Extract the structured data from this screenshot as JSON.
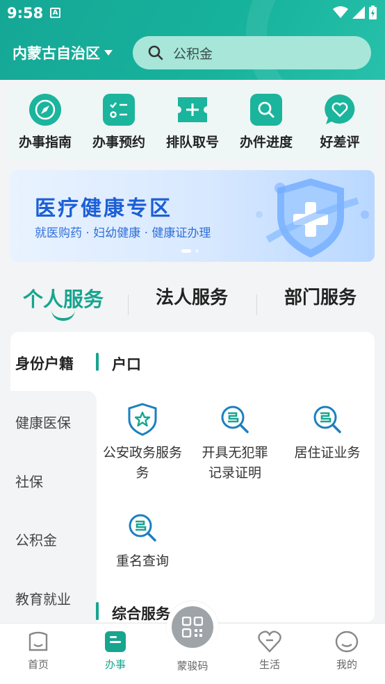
{
  "status_bar": {
    "time": "9:58",
    "notification_badge": "A"
  },
  "header": {
    "region": "内蒙古自治区",
    "search_placeholder": "公积金"
  },
  "quick_actions": [
    {
      "label": "办事指南",
      "icon": "compass-icon"
    },
    {
      "label": "办事预约",
      "icon": "checklist-icon"
    },
    {
      "label": "排队取号",
      "icon": "ticket-plus-icon"
    },
    {
      "label": "办件进度",
      "icon": "search-doc-icon"
    },
    {
      "label": "好差评",
      "icon": "heart-chat-icon"
    }
  ],
  "banner": {
    "title": "医疗健康专区",
    "subtitle": "就医购药 · 妇幼健康 · 健康证办理"
  },
  "tabs": [
    "个人服务",
    "法人服务",
    "部门服务"
  ],
  "sidebar": [
    "身份户籍",
    "健康医保",
    "社保",
    "公积金",
    "教育就业"
  ],
  "sections": {
    "hukou": "户口",
    "general": "综合服务"
  },
  "services": [
    "公安政务服务",
    "务",
    "开具无犯罪",
    "记录证明",
    "居住证业务",
    "重名查询"
  ],
  "bottom_nav": [
    "首页",
    "办事",
    "蒙骏码",
    "生活",
    "我的"
  ],
  "colors": {
    "brand_green": "#17a58f",
    "header_green": "#17b39c"
  }
}
